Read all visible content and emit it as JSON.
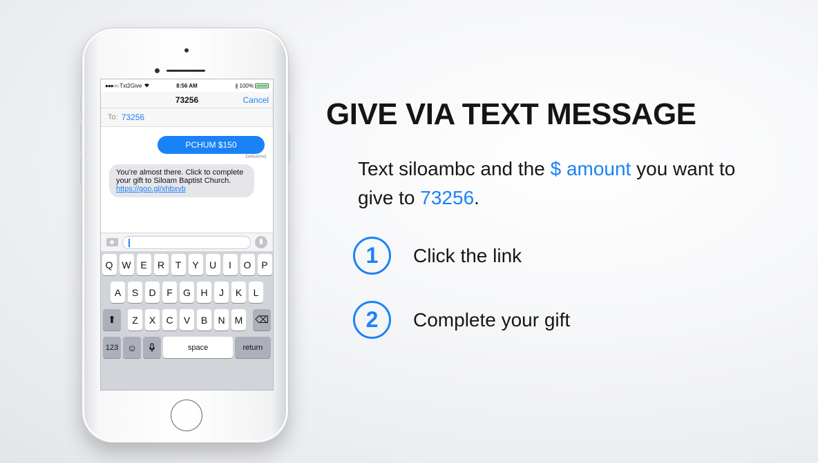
{
  "colors": {
    "accent": "#1a82f7",
    "bubble_in": "#e5e5ea",
    "heading": "#151515"
  },
  "phone": {
    "status_bar": {
      "signal": "●●●○○",
      "carrier": "Txt2Give",
      "wifi_icon": "wifi-icon",
      "time": "8:56 AM",
      "bluetooth": "∦",
      "battery": "100%"
    },
    "nav": {
      "title": "73256",
      "cancel": "Cancel"
    },
    "to": {
      "label": "To:",
      "value": "73256"
    },
    "messages": {
      "outgoing": "PCHUM $150",
      "status": "Delivered",
      "incoming": "You’re almost there. Click to complete your gift to Siloam Baptist Church.",
      "link": "https://goo.gl/xhbxvb"
    },
    "keyboard": {
      "row1": [
        "Q",
        "W",
        "E",
        "R",
        "T",
        "Y",
        "U",
        "I",
        "O",
        "P"
      ],
      "row2": [
        "A",
        "S",
        "D",
        "F",
        "G",
        "H",
        "J",
        "K",
        "L"
      ],
      "row3": [
        "Z",
        "X",
        "C",
        "V",
        "B",
        "N",
        "M"
      ],
      "shift": "⬆",
      "backspace": "⌫",
      "numbers": "123",
      "emoji": "☺",
      "mic": "🎙",
      "space": "space",
      "return": "return"
    }
  },
  "headline": "GIVE VIA TEXT MESSAGE",
  "instruction": {
    "part1": "Text siloambc and the ",
    "amount": "$ amount",
    "part2": " you want to give to ",
    "number": "73256",
    "part3": "."
  },
  "steps": [
    {
      "number": "1",
      "text": "Click the link"
    },
    {
      "number": "2",
      "text": "Complete your gift"
    }
  ]
}
